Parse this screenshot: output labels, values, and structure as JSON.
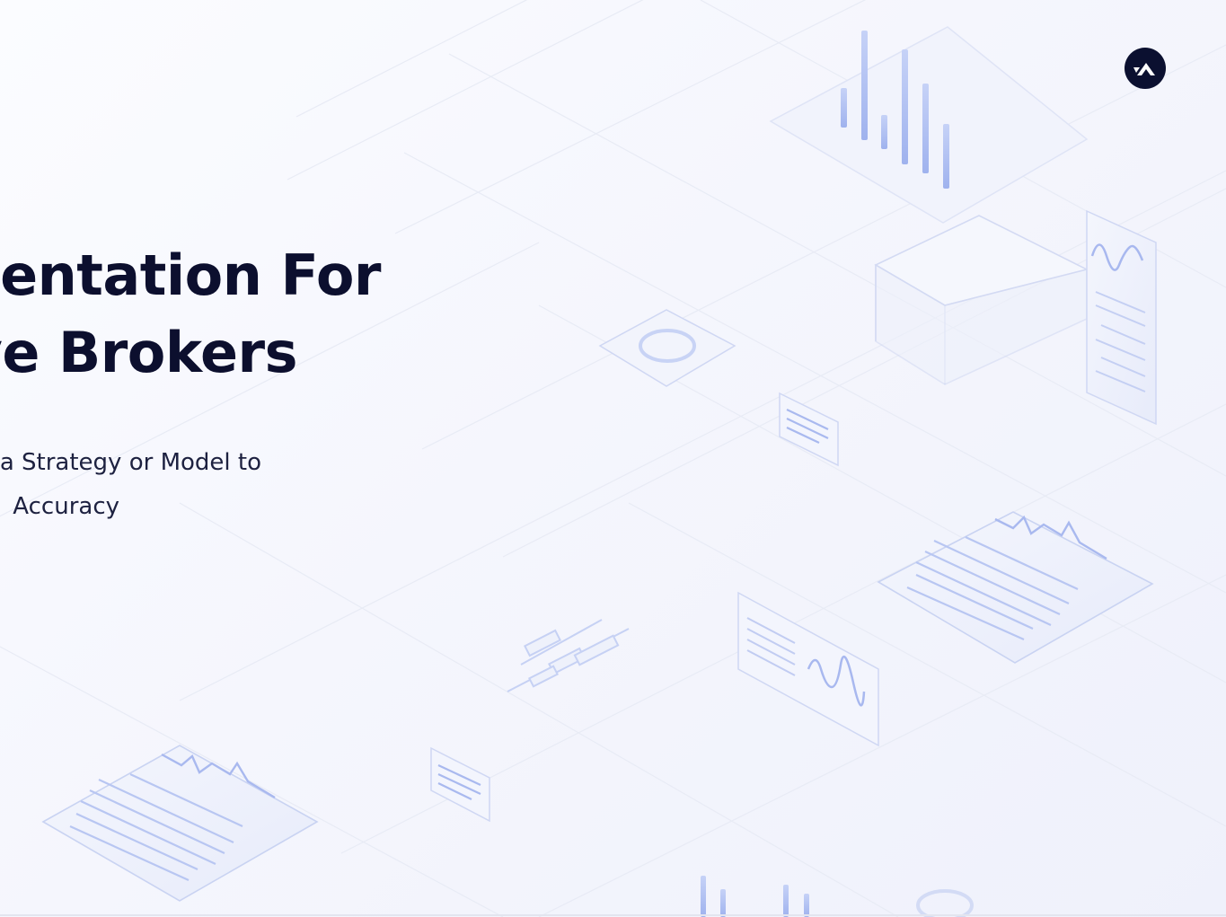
{
  "slide": {
    "title_line_1": "sentation For",
    "title_line_2": "ve Brokers",
    "subtitle_line_1": "a Strategy or Model to",
    "subtitle_line_2": "Accuracy"
  },
  "logo": {
    "icon": "mountain-logo-icon",
    "background": "#0b1030"
  },
  "colors": {
    "title": "#0c0f2e",
    "subtitle": "#1d2140",
    "illustration_accent": "#b9c7f5"
  }
}
